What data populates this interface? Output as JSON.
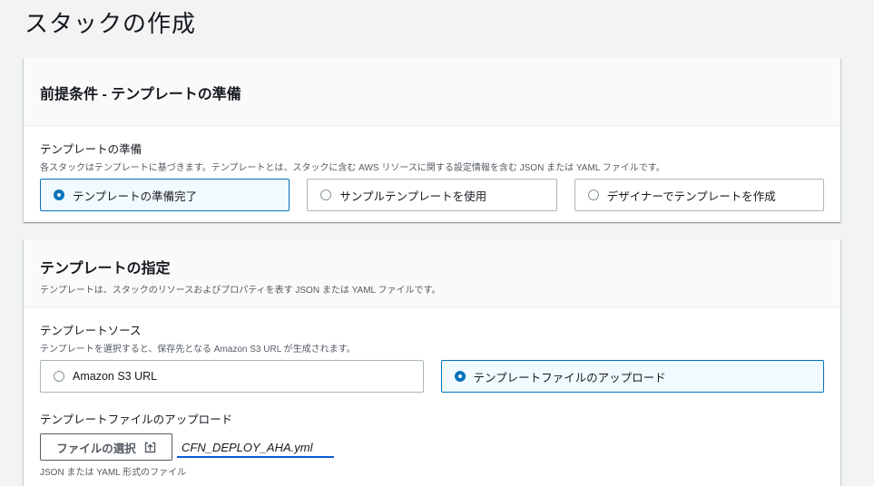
{
  "page_title": "スタックの作成",
  "prerequisite": {
    "title": "前提条件 - テンプレートの準備",
    "field_label": "テンプレートの準備",
    "field_desc": "各スタックはテンプレートに基づきます。テンプレートとは、スタックに含む AWS リソースに関する設定情報を含む JSON または YAML ファイルです。",
    "options": [
      {
        "label": "テンプレートの準備完了",
        "selected": true
      },
      {
        "label": "サンプルテンプレートを使用",
        "selected": false
      },
      {
        "label": "デザイナーでテンプレートを作成",
        "selected": false
      }
    ]
  },
  "specify": {
    "title": "テンプレートの指定",
    "desc": "テンプレートは、スタックのリソースおよびプロパティを表す JSON または YAML ファイルです。",
    "source_label": "テンプレートソース",
    "source_desc": "テンプレートを選択すると、保存先となる Amazon S3 URL が生成されます。",
    "source_options": [
      {
        "label": "Amazon S3 URL",
        "selected": false
      },
      {
        "label": "テンプレートファイルのアップロード",
        "selected": true
      }
    ],
    "upload_label": "テンプレートファイルのアップロード",
    "choose_file_label": "ファイルの選択",
    "file_name": "CFN_DEPLOY_AHA.yml",
    "constraint": "JSON または YAML 形式のファイル"
  },
  "icons": {
    "upload": "upload-icon",
    "radio": "radio-icon"
  },
  "colors": {
    "accent": "#0073bb",
    "selected_bg": "#f1faff",
    "filename_underline": "#0a5bd6"
  }
}
